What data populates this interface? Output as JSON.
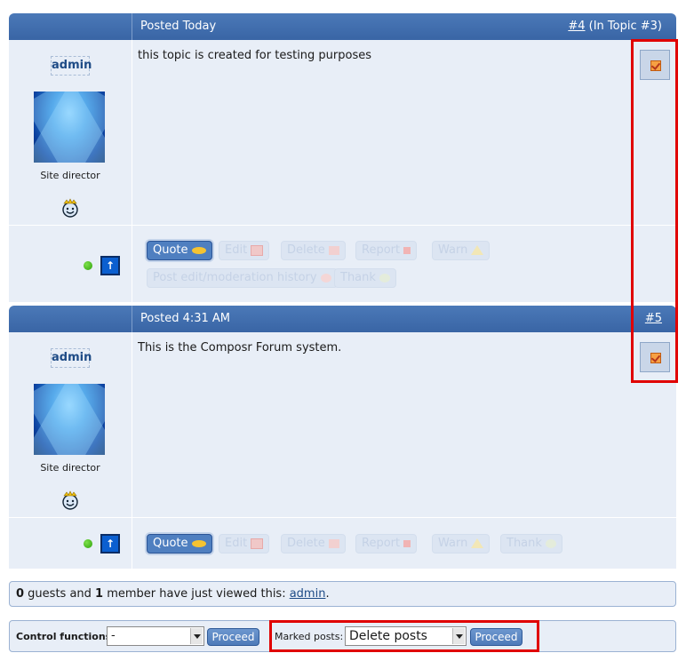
{
  "posts": [
    {
      "posted": "Posted Today",
      "ref_link": "#4",
      "ref_suffix": " (In Topic #3)",
      "username": "admin",
      "role": "Site director",
      "content": "this topic is created for testing purposes",
      "buttons": {
        "quote": "Quote",
        "edit": "Edit",
        "delete": "Delete",
        "report": "Report",
        "warn": "Warn",
        "history": "Post edit/moderation history",
        "thank": "Thank"
      }
    },
    {
      "posted": "Posted 4:31 AM",
      "ref_link": "#5",
      "ref_suffix": "",
      "username": "admin",
      "role": "Site director",
      "content": "This is the Composr Forum system.",
      "buttons": {
        "quote": "Quote",
        "edit": "Edit",
        "delete": "Delete",
        "report": "Report",
        "warn": "Warn",
        "thank": "Thank"
      }
    }
  ],
  "viewers": {
    "guests_count": "0",
    "text1": " guests and ",
    "members_count": "1",
    "text2": " member have just viewed this: ",
    "member_link": "admin",
    "end": "."
  },
  "controls": {
    "control_functions_label": "Control functions:",
    "control_functions_value": "-",
    "proceed_label": "Proceed",
    "marked_posts_label": "Marked posts:",
    "marked_posts_value": "Delete posts",
    "marked_proceed_label": "Proceed"
  },
  "colors": {
    "header_blue": "#3965a5",
    "post_bg": "#e8eef7",
    "highlight": "#e00000"
  }
}
